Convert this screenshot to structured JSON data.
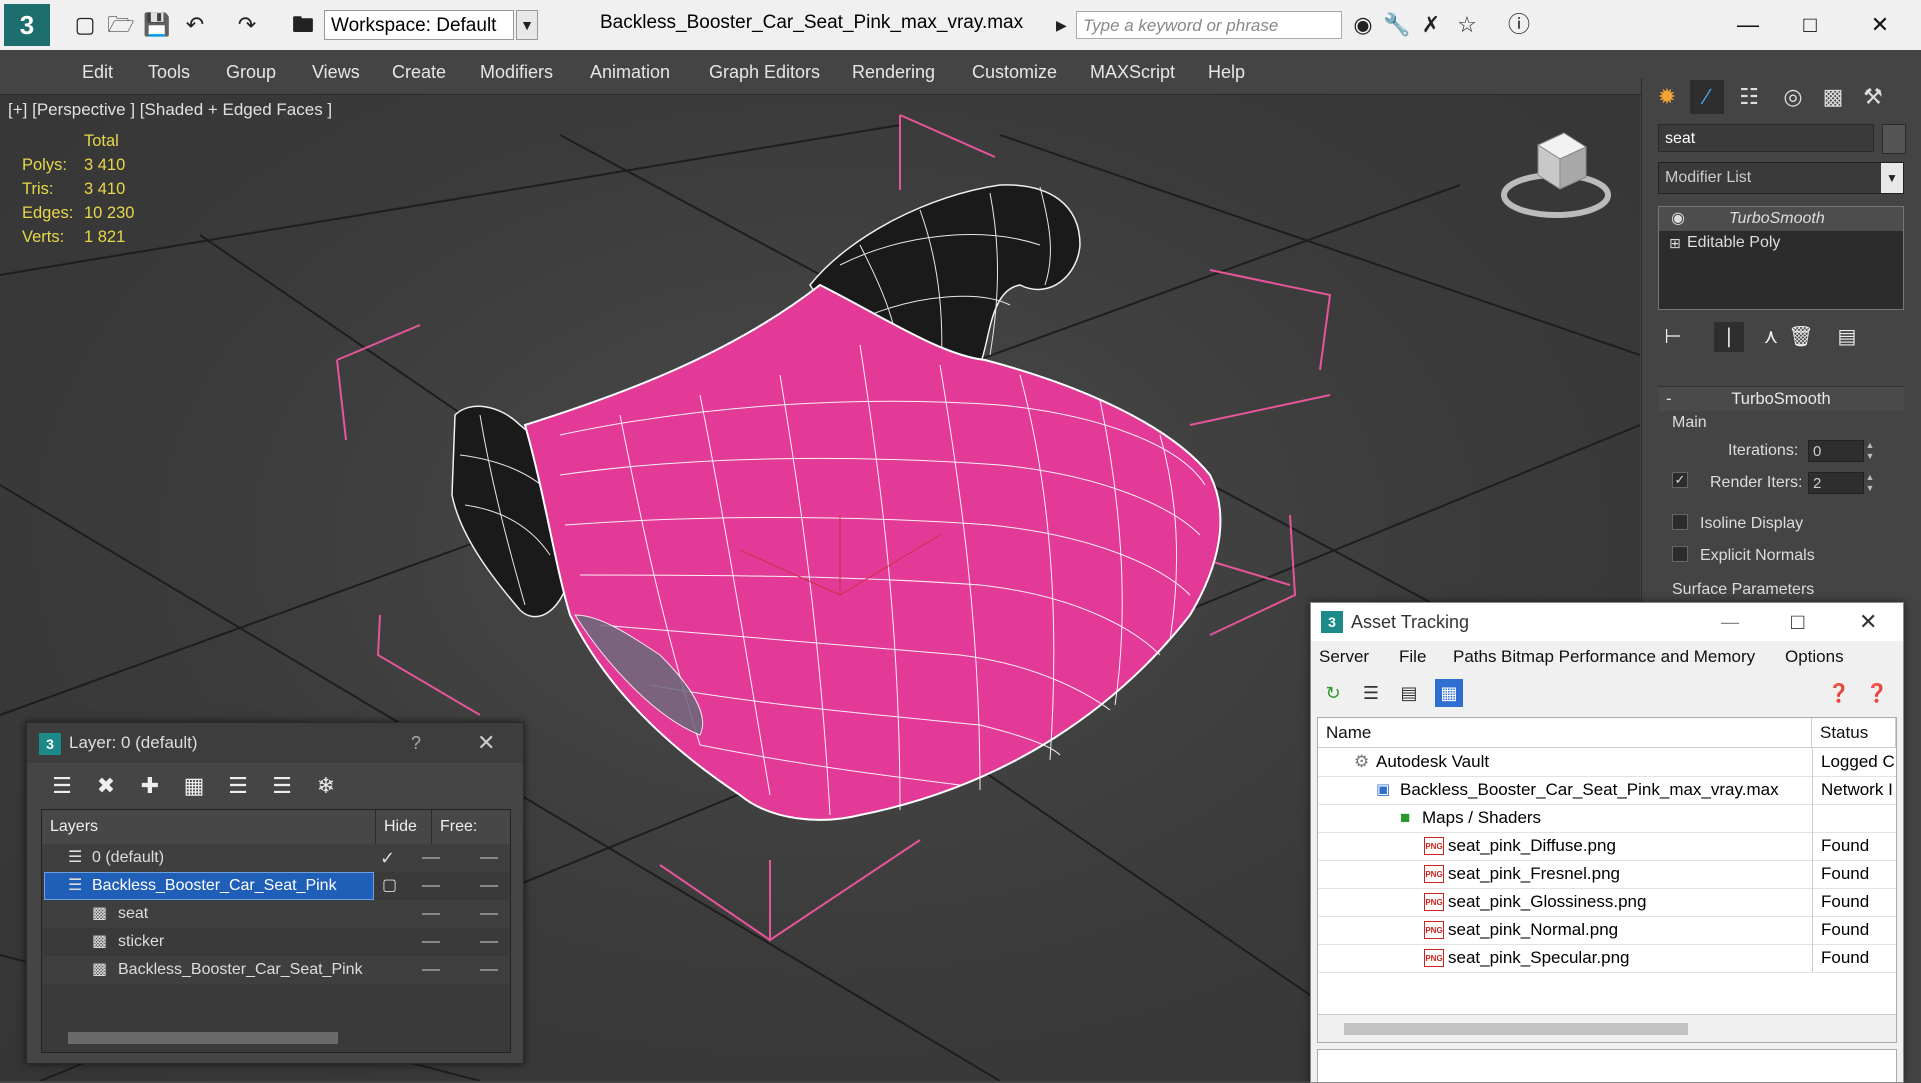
{
  "app": {
    "doc_title": "Backless_Booster_Car_Seat_Pink_max_vray.max",
    "workspace": "Workspace: Default",
    "search_placeholder": "Type a keyword or phrase"
  },
  "menu": [
    "Edit",
    "Tools",
    "Group",
    "Views",
    "Create",
    "Modifiers",
    "Animation",
    "Graph Editors",
    "Rendering",
    "Customize",
    "MAXScript",
    "Help"
  ],
  "viewport": {
    "label": "[+] [Perspective ] [Shaded + Edged Faces ]",
    "stats_header": "Total",
    "stats": [
      {
        "label": "Polys:",
        "value": "3 410"
      },
      {
        "label": "Tris:",
        "value": "3 410"
      },
      {
        "label": "Edges:",
        "value": "10 230"
      },
      {
        "label": "Verts:",
        "value": "1 821"
      }
    ],
    "colors": {
      "model": "#e63a9a",
      "wire": "#ffffff",
      "bbox": "#e65a9a"
    }
  },
  "command_panel": {
    "object_name": "seat",
    "modifier_list": "Modifier List",
    "stack": [
      "TurboSmooth",
      "Editable Poly"
    ],
    "rollout": "TurboSmooth",
    "group_main": "Main",
    "iterations_label": "Iterations:",
    "iterations": "0",
    "render_iters_label": "Render Iters:",
    "render_iters": "2",
    "isoline": "Isoline Display",
    "explicit_normals": "Explicit Normals",
    "surface_params": "Surface Parameters"
  },
  "layer_dialog": {
    "title": "Layer: 0 (default)",
    "help": "?",
    "col_layers": "Layers",
    "col_hide": "Hide",
    "col_freeze": "Free:",
    "rows": [
      {
        "name": "0 (default)"
      },
      {
        "name": "Backless_Booster_Car_Seat_Pink"
      },
      {
        "name": "seat"
      },
      {
        "name": "sticker"
      },
      {
        "name": "Backless_Booster_Car_Seat_Pink"
      }
    ]
  },
  "asset_dialog": {
    "title": "Asset Tracking",
    "menu": [
      "Server",
      "File",
      "Paths",
      "Bitmap Performance and Memory",
      "Options"
    ],
    "col_name": "Name",
    "col_status": "Status",
    "rows": [
      {
        "name": "Autodesk Vault",
        "status": "Logged C"
      },
      {
        "name": "Backless_Booster_Car_Seat_Pink_max_vray.max",
        "status": "Network I"
      },
      {
        "name": "Maps / Shaders",
        "status": ""
      },
      {
        "name": "seat_pink_Diffuse.png",
        "status": "Found"
      },
      {
        "name": "seat_pink_Fresnel.png",
        "status": "Found"
      },
      {
        "name": "seat_pink_Glossiness.png",
        "status": "Found"
      },
      {
        "name": "seat_pink_Normal.png",
        "status": "Found"
      },
      {
        "name": "seat_pink_Specular.png",
        "status": "Found"
      }
    ]
  }
}
